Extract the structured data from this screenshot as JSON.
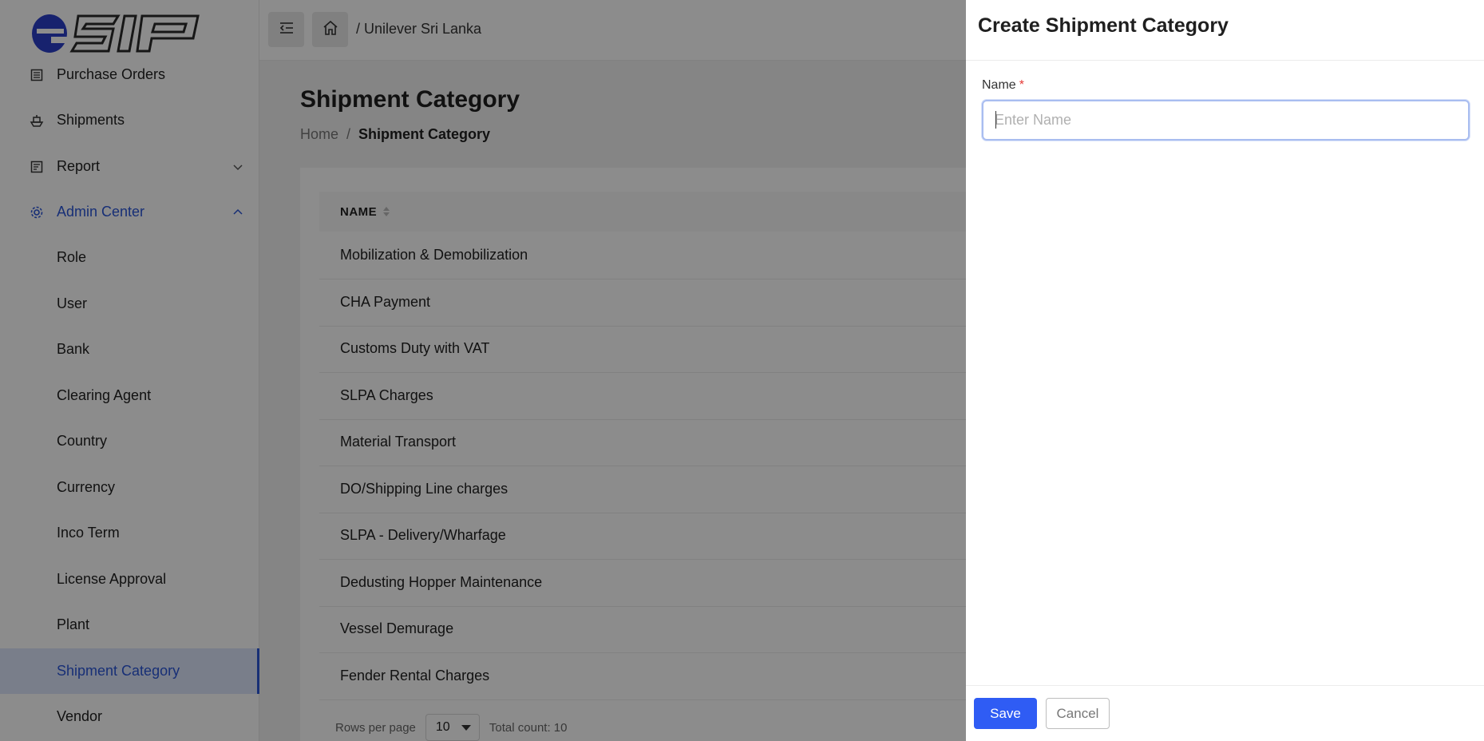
{
  "app": {
    "logo_text": "eSIP"
  },
  "sidebar": {
    "items": [
      {
        "label": "Purchase Orders",
        "icon": "list-icon"
      },
      {
        "label": "Shipments",
        "icon": "ship-icon"
      },
      {
        "label": "Report",
        "icon": "report-icon"
      },
      {
        "label": "Admin Center",
        "icon": "gear-icon"
      }
    ],
    "admin_sub_items": [
      {
        "label": "Role"
      },
      {
        "label": "User"
      },
      {
        "label": "Bank"
      },
      {
        "label": "Clearing Agent"
      },
      {
        "label": "Country"
      },
      {
        "label": "Currency"
      },
      {
        "label": "Inco Term"
      },
      {
        "label": "License Approval"
      },
      {
        "label": "Plant"
      },
      {
        "label": "Shipment Category"
      },
      {
        "label": "Vendor"
      }
    ],
    "selected": "Shipment Category"
  },
  "header": {
    "breadcrumb": "/ Unilever Sri Lanka"
  },
  "main": {
    "title": "Shipment Category",
    "breadcrumb_home": "Home",
    "breadcrumb_sep": "/",
    "breadcrumb_current": "Shipment Category",
    "table": {
      "columns": [
        "NAME"
      ],
      "rows": [
        "Mobilization & Demobilization",
        "CHA Payment",
        "Customs Duty with VAT",
        "SLPA Charges",
        "Material Transport",
        "DO/Shipping Line charges",
        "SLPA - Delivery/Wharfage",
        "Dedusting Hopper Maintenance",
        "Vessel Demurage",
        "Fender Rental Charges"
      ]
    },
    "pager": {
      "rows_per_page_label": "Rows per page",
      "rows_per_page_value": "10",
      "total_label": "Total count: 10"
    }
  },
  "drawer": {
    "title": "Create Shipment Category",
    "name_label": "Name",
    "required_mark": "*",
    "name_placeholder": "Enter Name",
    "name_value": "",
    "save_label": "Save",
    "cancel_label": "Cancel"
  },
  "colors": {
    "accent": "#2f5cf4",
    "active_nav": "#2b56d8",
    "selected_bg": "#dde6fb",
    "required": "#e53935"
  }
}
